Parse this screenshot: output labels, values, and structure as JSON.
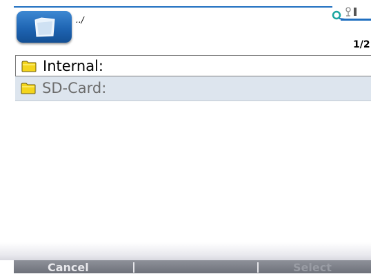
{
  "header": {
    "path": "../",
    "page_counter": "1/2",
    "app_icon": "folder-icon",
    "status_icon": "network-status-icon"
  },
  "list": {
    "items": [
      {
        "label": "Internal:",
        "icon": "folder-icon",
        "selected": true
      },
      {
        "label": "SD-Card:",
        "icon": "folder-icon",
        "selected": false
      }
    ]
  },
  "softkeys": {
    "left_label": "Cancel",
    "right_label": "Select"
  },
  "colors": {
    "accent": "#1f6fc0",
    "folder_yellow": "#f2d21f",
    "row_bg": "#dde5ee",
    "softkey_bg": "#7c7f88"
  }
}
